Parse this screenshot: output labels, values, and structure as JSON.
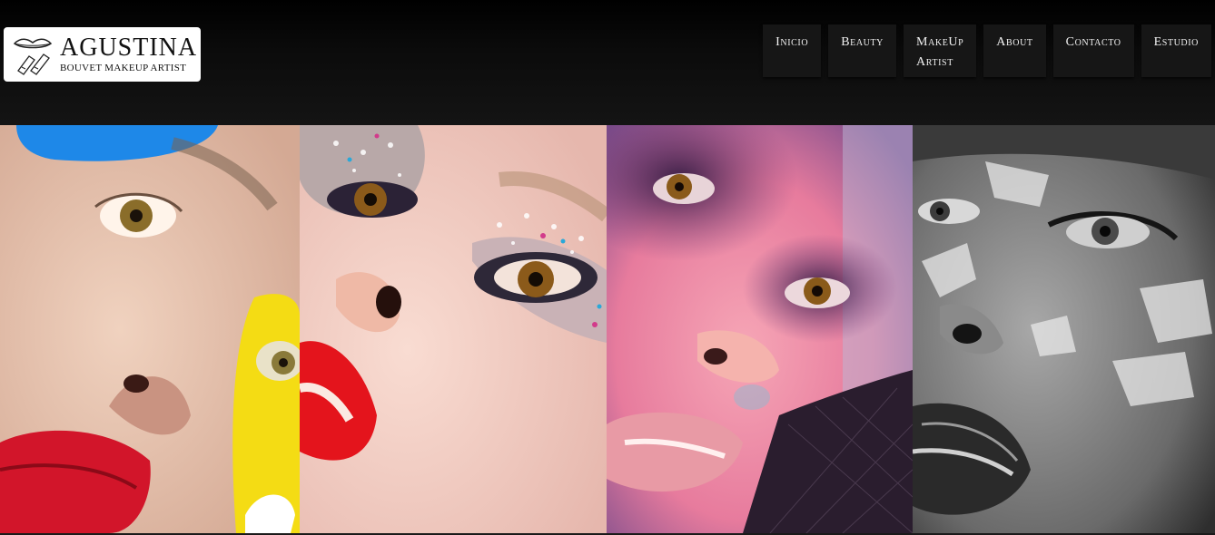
{
  "brand": {
    "title": "AGUSTINA",
    "subtitle": "BOUVET MAKEUP ARTIST",
    "logo_icon": "lips-brush-icon"
  },
  "nav": {
    "items": [
      {
        "label": "Inicio"
      },
      {
        "label": "Beauty"
      },
      {
        "label": "MakeUp",
        "label2": "Artist"
      },
      {
        "label": "About"
      },
      {
        "label": "Contacto"
      },
      {
        "label": "Estudio"
      }
    ]
  },
  "gallery": {
    "photos": [
      {
        "subject": "face-blue-yellow-red-lips"
      },
      {
        "subject": "face-star-glitter-eyes"
      },
      {
        "subject": "face-pink-purple-smoky"
      },
      {
        "subject": "face-bw-cracked-texture"
      }
    ]
  },
  "colors": {
    "header_bg": "#0f0f0f",
    "nav_bg": "#161616",
    "nav_text": "#f2f2f2",
    "logo_bg": "#ffffff"
  }
}
